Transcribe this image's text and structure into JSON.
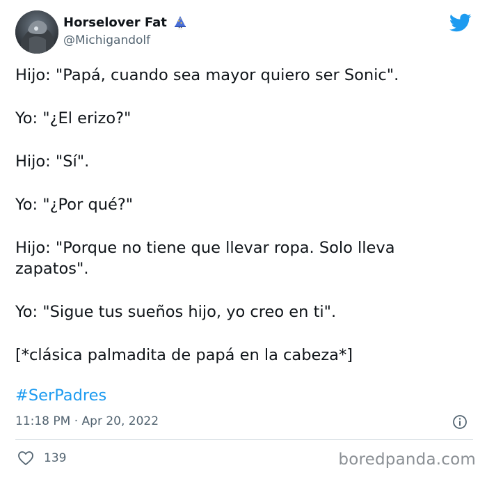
{
  "author": {
    "display_name": "Horselover Fat",
    "handle": "@Michigandolf",
    "badge_icon": "wizard-icon"
  },
  "platform_icon": "twitter-bird-icon",
  "tweet": {
    "lines": [
      "Hijo: \"Papá, cuando sea mayor quiero ser Sonic\".",
      "Yo: \"¿El erizo?\"",
      "Hijo: \"Sí\".",
      "Yo: \"¿Por qué?\"",
      "Hijo: \"Porque no tiene que llevar ropa. Solo lleva zapatos\".",
      "Yo: \"Sigue tus sueños hijo, yo creo en ti\".",
      "[*clásica palmadita de papá en la cabeza*]"
    ],
    "hashtag": "#SerPadres"
  },
  "meta": {
    "timestamp": "11:18 PM · Apr 20, 2022",
    "info_icon": "info-icon"
  },
  "engagement": {
    "like_icon": "heart-icon",
    "likes": "139"
  },
  "watermark": "boredpanda.com",
  "colors": {
    "text": "#0f1419",
    "secondary": "#536471",
    "accent": "#1d9bf0",
    "divider": "#cfd9de"
  }
}
